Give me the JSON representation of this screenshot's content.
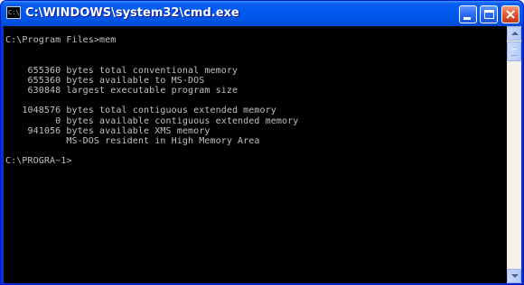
{
  "window": {
    "title": "C:\\WINDOWS\\system32\\cmd.exe",
    "icon_label": "C:\\",
    "controls": {
      "minimize": "minimize-icon",
      "maximize": "maximize-icon",
      "close": "close-icon"
    }
  },
  "console": {
    "lines": [
      "C:\\Program Files>mem",
      "",
      "",
      "    655360 bytes total conventional memory",
      "    655360 bytes available to MS-DOS",
      "    630848 largest executable program size",
      "",
      "   1048576 bytes total contiguous extended memory",
      "         0 bytes available contiguous extended memory",
      "    941056 bytes available XMS memory",
      "           MS-DOS resident in High Memory Area",
      "",
      "C:\\PROGRA~1>"
    ]
  },
  "colors": {
    "titlebar": "#0054e3",
    "console_bg": "#000000",
    "console_fg": "#c0c0c0",
    "close_button": "#e2552e"
  }
}
